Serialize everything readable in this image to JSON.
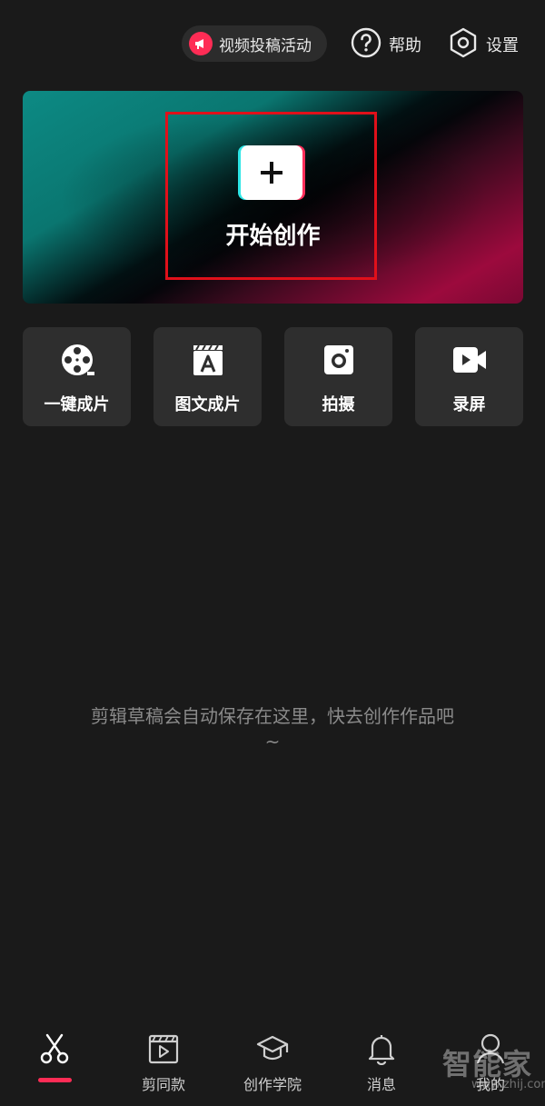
{
  "top_bar": {
    "campaign_label": "视频投稿活动",
    "help_label": "帮助",
    "settings_label": "设置"
  },
  "hero": {
    "start_label": "开始创作"
  },
  "tools": [
    {
      "label": "一键成片",
      "icon": "film-reel-icon"
    },
    {
      "label": "图文成片",
      "icon": "clapboard-text-icon"
    },
    {
      "label": "拍摄",
      "icon": "camera-icon"
    },
    {
      "label": "录屏",
      "icon": "video-record-icon"
    }
  ],
  "empty_state": {
    "message": "剪辑草稿会自动保存在这里，快去创作作品吧~"
  },
  "bottom_nav": {
    "items": [
      {
        "label": "",
        "icon": "scissors-icon",
        "active": true
      },
      {
        "label": "剪同款",
        "icon": "clapboard-play-icon"
      },
      {
        "label": "创作学院",
        "icon": "graduation-cap-icon"
      },
      {
        "label": "消息",
        "icon": "bell-icon"
      },
      {
        "label": "我的",
        "icon": "person-icon"
      }
    ]
  },
  "watermark": {
    "text": "智能家",
    "sub": "www.zhij.com"
  },
  "colors": {
    "background": "#1a1a1a",
    "accent": "#fe2c55",
    "card": "#2e2e2e",
    "highlight_box": "#e0101a"
  }
}
